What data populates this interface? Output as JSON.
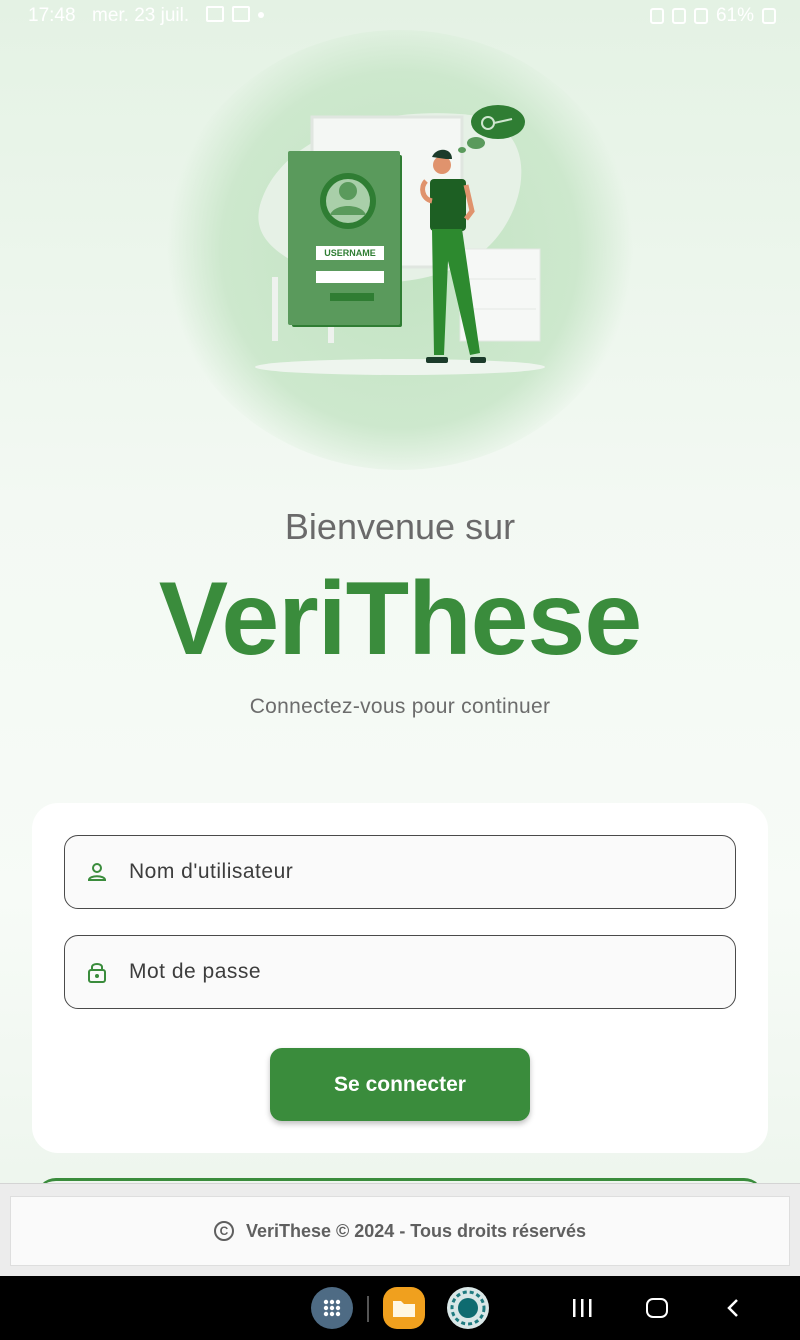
{
  "status_bar": {
    "time": "17:48",
    "date": "mer. 23 juil.",
    "battery": "61%"
  },
  "illustration": {
    "card_label": "USERNAME"
  },
  "welcome": {
    "greeting": "Bienvenue sur",
    "app_name": "VeriThese",
    "subtitle": "Connectez-vous pour continuer"
  },
  "login_form": {
    "username_placeholder": "Nom d'utilisateur",
    "password_placeholder": "Mot de passe",
    "submit_label": "Se connecter"
  },
  "footer": {
    "copyright_text": "VeriThese © 2024 - Tous droits réservés"
  },
  "colors": {
    "brand_green": "#3a8c3c",
    "background_tint": "#e4f2e4"
  },
  "icons": [
    "person-icon",
    "lock-icon",
    "copyright-icon"
  ]
}
